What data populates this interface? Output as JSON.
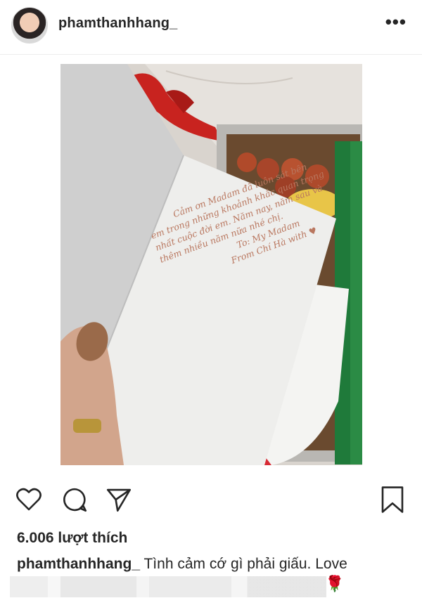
{
  "post": {
    "username": "phamthanhhang_",
    "more_icon": "•••",
    "likes_text": "6.006 lượt thích",
    "caption_user": "phamthanhhang_",
    "caption_text": "Tình cảm cớ gì phải giấu. Love",
    "caption_emoji": "🌹"
  },
  "card": {
    "line1": "Cảm ơn Madam đã luôn sát bên",
    "line2": "em trong những khoảnh khắc quan trọng",
    "line3": "nhất cuộc đời em. Năm nay, năm sau và",
    "line4": "thêm nhiều năm nữa nhé chị.",
    "line5": "To: My Madam",
    "line6": "From Chí Hà with ♥"
  },
  "icons": {
    "like": "heart-icon",
    "comment": "comment-icon",
    "share": "share-icon",
    "save": "bookmark-icon"
  }
}
